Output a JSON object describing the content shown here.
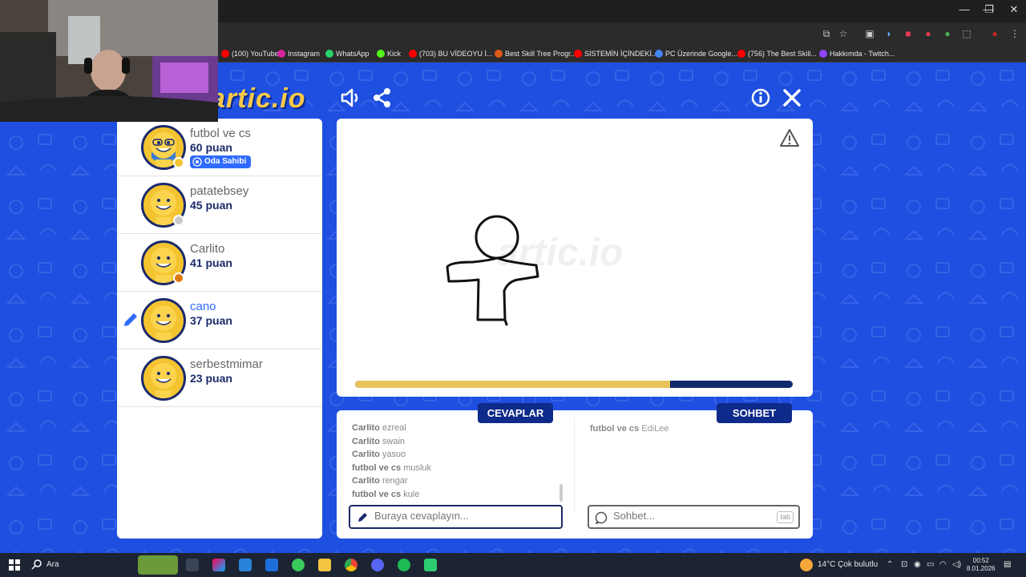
{
  "browser": {
    "window_controls": [
      "—",
      "❐",
      "✕"
    ],
    "bookmarks": [
      {
        "label": "(100) YouTube",
        "color": "#ff0000"
      },
      {
        "label": "Instagram",
        "color": "#d6249f"
      },
      {
        "label": "WhatsApp",
        "color": "#25d366"
      },
      {
        "label": "Kick",
        "color": "#53fc18"
      },
      {
        "label": "(703) BU VİDEOYU İ...",
        "color": "#ff0000"
      },
      {
        "label": "Best Skill Tree Progr...",
        "color": "#e05a1a"
      },
      {
        "label": "SİSTEMİN İÇİNDEKİ...",
        "color": "#ff0000"
      },
      {
        "label": "PC Üzerinde Google...",
        "color": "#4285f4"
      },
      {
        "label": "(756) The Best Skill...",
        "color": "#ff0000"
      },
      {
        "label": "Hakkımda - Twitch...",
        "color": "#9146ff"
      }
    ]
  },
  "game": {
    "logo": "artic.io",
    "watermark": "artic.io",
    "players": [
      {
        "name": "futbol ve cs",
        "points": "60 puan",
        "status_color": "#f4c430",
        "owner": true,
        "drawing": false
      },
      {
        "name": "patatebsey",
        "points": "45 puan",
        "status_color": "#c8c8c8",
        "owner": false,
        "drawing": false
      },
      {
        "name": "Carlito",
        "points": "41 puan",
        "status_color": "#e07a10",
        "owner": false,
        "drawing": false
      },
      {
        "name": "cano",
        "points": "37 puan",
        "status_color": "",
        "owner": false,
        "drawing": true
      },
      {
        "name": "serbestmimar",
        "points": "23 puan",
        "status_color": "",
        "owner": false,
        "drawing": false
      }
    ],
    "owner_badge": "Oda Sahibi",
    "progress_fraction": 0.72,
    "answers_tab": "CEVAPLAR",
    "chat_tab": "SOHBET",
    "answers": [
      {
        "user": "Carlito",
        "text": "ezreal"
      },
      {
        "user": "Carlito",
        "text": "swain"
      },
      {
        "user": "Carlito",
        "text": "yasuo"
      },
      {
        "user": "futbol ve cs",
        "text": "musluk"
      },
      {
        "user": "Carlito",
        "text": "rengar"
      },
      {
        "user": "futbol ve cs",
        "text": "kule"
      }
    ],
    "chat": [
      {
        "user": "futbol ve cs",
        "text": "EdiLee"
      }
    ],
    "answer_placeholder": "Buraya cevaplayın...",
    "chat_placeholder": "Sohbet...",
    "tab_hint": "tab"
  },
  "taskbar": {
    "search_label": "Ara",
    "weather": "14°C  Çok bulutlu",
    "time": "00:52",
    "date": "8.01.2026"
  }
}
